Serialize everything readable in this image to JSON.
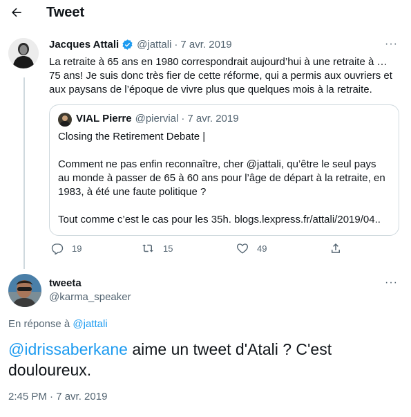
{
  "header": {
    "title": "Tweet"
  },
  "tweet1": {
    "name": "Jacques Attali",
    "handle": "@jattali",
    "sep": "·",
    "date": "7 avr. 2019",
    "text": "La retraite à 65 ans en 1980 correspondrait aujourd’hui à une retraite à …\n75 ans! Je suis donc  très fier de cette réforme, qui a permis aux ouvriers et\naux paysans de l’époque de vivre plus que quelques mois à la retraite.",
    "quote": {
      "name": "VIAL Pierre",
      "handle": "@piervial",
      "sep": "·",
      "date": "7 avr. 2019",
      "line1": "Closing the Retirement Debate |",
      "para": "Comment ne pas enfin reconnaître, cher @jattali, qu’être le seul pays\nau monde à passer de 65 à 60 ans pour l’âge de départ à la retraite, en\n1983, à été une faute politique ?",
      "last": "Tout comme c’est le cas pour les 35h. blogs.lexpress.fr/attali/2019/04.."
    },
    "replies": "19",
    "retweets": "15",
    "likes": "49"
  },
  "tweet2": {
    "name": "tweeta",
    "handle": "@karma_speaker",
    "reply_prefix": "En réponse à",
    "reply_to": "@jattali",
    "mention": "@idrissaberkane",
    "text_rest": " aime un tweet d'Atali ? C'est",
    "text_line2": "douloureux.",
    "timestamp": "2:45 PM · 7 avr. 2019"
  },
  "colors": {
    "accent": "#1d9bf0",
    "secondary": "#536471",
    "border": "#cfd9de",
    "verified": "#1d9bf0"
  }
}
